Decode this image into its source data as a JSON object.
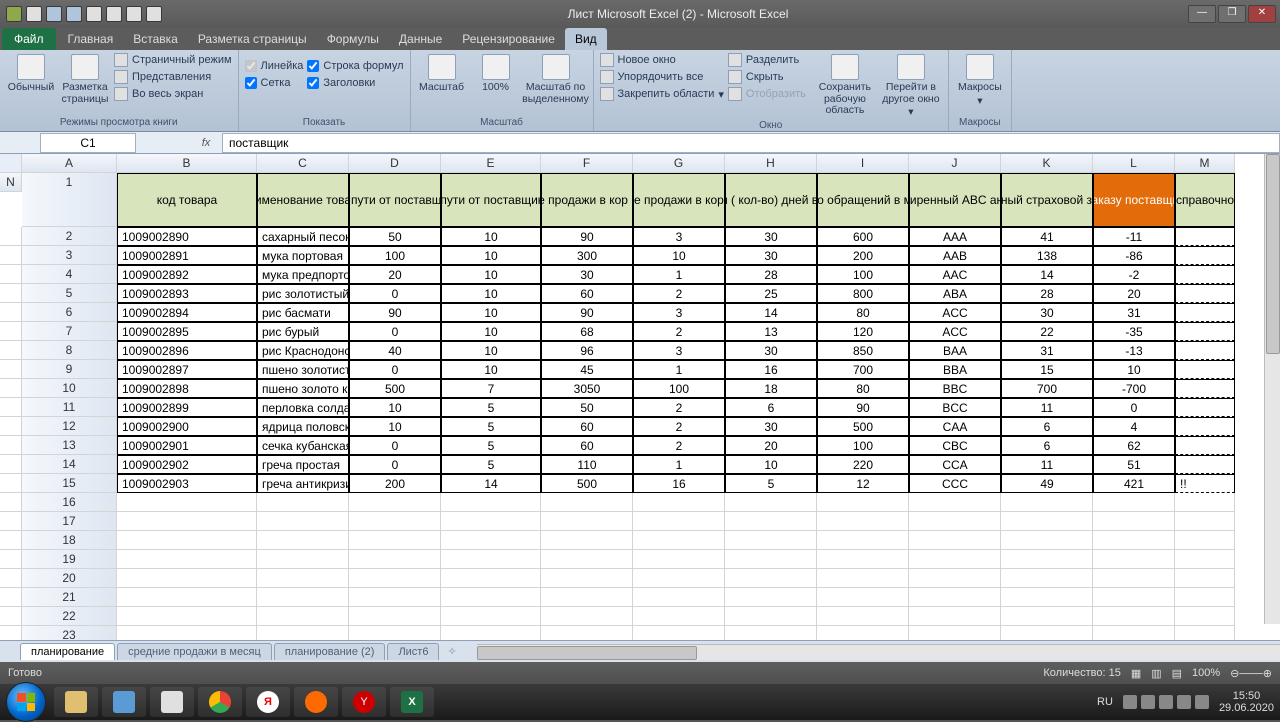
{
  "titlebar": {
    "title": "Лист Microsoft Excel (2)  -  Microsoft Excel"
  },
  "tabs": {
    "file": "Файл",
    "t1": "Главная",
    "t2": "Вставка",
    "t3": "Разметка страницы",
    "t4": "Формулы",
    "t5": "Данные",
    "t6": "Рецензирование",
    "t7": "Вид"
  },
  "ribbon": {
    "group_views": {
      "normal": "Обычный",
      "pagelayout": "Разметка страницы",
      "pagebreak": "Страничный режим",
      "customviews": "Представления",
      "fullscreen": "Во весь экран",
      "label": "Режимы просмотра книги"
    },
    "group_show": {
      "ruler": "Линейка",
      "formulabar": "Строка формул",
      "gridlines": "Сетка",
      "headings": "Заголовки",
      "label": "Показать"
    },
    "group_zoom": {
      "zoom": "Масштаб",
      "z100": "100%",
      "zoomsel": "Масштаб по выделенному",
      "label": "Масштаб"
    },
    "group_window": {
      "newwin": "Новое окно",
      "arrange": "Упорядочить все",
      "freeze": "Закрепить области",
      "split": "Разделить",
      "hide": "Скрыть",
      "unhide": "Отобразить",
      "savews": "Сохранить рабочую область",
      "switchwin": "Перейти в другое окно",
      "label": "Окно"
    },
    "group_macros": {
      "macros": "Макросы",
      "label": "Макросы"
    }
  },
  "namebox": "C1",
  "fx": "поставщик",
  "cols": [
    "A",
    "B",
    "C",
    "D",
    "E",
    "F",
    "G",
    "H",
    "I",
    "J",
    "K",
    "L",
    "M",
    "N"
  ],
  "headers": {
    "A": "код товара",
    "B": "наименование товара",
    "C": "товары в пути от поставщика в кор",
    "D": "время в пути от поставщика в днях",
    "E": "средние продажи в кор в месяц",
    "F": "средние продажи в кор в день",
    "G": "продажи  ( кол-во) дней в месяце",
    "H": "кол-во обращений в месяц",
    "I": "расширенный ABC анализ",
    "J": "минимальный страховой запас в  кор",
    "K": "к заказу поставщику",
    "L": "справочно"
  },
  "rows": [
    {
      "n": 2,
      "A": "1009002890",
      "B": "сахарный песок",
      "C": "50",
      "D": "10",
      "E": "90",
      "F": "3",
      "G": "30",
      "H": "600",
      "I": "AAA",
      "J": "41",
      "K": "-11",
      "L": ""
    },
    {
      "n": 3,
      "A": "1009002891",
      "B": "мука портовая",
      "C": "100",
      "D": "10",
      "E": "300",
      "F": "10",
      "G": "30",
      "H": "200",
      "I": "AAB",
      "J": "138",
      "K": "-86",
      "L": ""
    },
    {
      "n": 4,
      "A": "1009002892",
      "B": "мука предпортовая",
      "C": "20",
      "D": "10",
      "E": "30",
      "F": "1",
      "G": "28",
      "H": "100",
      "I": "AAC",
      "J": "14",
      "K": "-2",
      "L": ""
    },
    {
      "n": 5,
      "A": "1009002893",
      "B": "рис золотистый",
      "C": "0",
      "D": "10",
      "E": "60",
      "F": "2",
      "G": "25",
      "H": "800",
      "I": "ABA",
      "J": "28",
      "K": "20",
      "L": ""
    },
    {
      "n": 6,
      "A": "1009002894",
      "B": "рис басмати",
      "C": "90",
      "D": "10",
      "E": "90",
      "F": "3",
      "G": "14",
      "H": "80",
      "I": "ACC",
      "J": "30",
      "K": "31",
      "L": ""
    },
    {
      "n": 7,
      "A": "1009002895",
      "B": "рис бурый",
      "C": "0",
      "D": "10",
      "E": "68",
      "F": "2",
      "G": "13",
      "H": "120",
      "I": "ACC",
      "J": "22",
      "K": "-35",
      "L": ""
    },
    {
      "n": 8,
      "A": "1009002896",
      "B": "рис Краснодонский",
      "C": "40",
      "D": "10",
      "E": "96",
      "F": "3",
      "G": "30",
      "H": "850",
      "I": "BAA",
      "J": "31",
      "K": "-13",
      "L": ""
    },
    {
      "n": 9,
      "A": "1009002897",
      "B": "пшено золотистое",
      "C": "0",
      "D": "10",
      "E": "45",
      "F": "1",
      "G": "16",
      "H": "700",
      "I": "BBA",
      "J": "15",
      "K": "10",
      "L": ""
    },
    {
      "n": 10,
      "A": "1009002898",
      "B": "пшено золото края",
      "C": "500",
      "D": "7",
      "E": "3050",
      "F": "100",
      "G": "18",
      "H": "80",
      "I": "BBC",
      "J": "700",
      "K": "-700",
      "L": ""
    },
    {
      "n": 11,
      "A": "1009002899",
      "B": "перловка солдатская",
      "C": "10",
      "D": "5",
      "E": "50",
      "F": "2",
      "G": "6",
      "H": "90",
      "I": "BCC",
      "J": "11",
      "K": "0",
      "L": ""
    },
    {
      "n": 12,
      "A": "1009002900",
      "B": "ядрица половская",
      "C": "10",
      "D": "5",
      "E": "60",
      "F": "2",
      "G": "30",
      "H": "500",
      "I": "CAA",
      "J": "6",
      "K": "4",
      "L": ""
    },
    {
      "n": 13,
      "A": "1009002901",
      "B": "сечка кубанская",
      "C": "0",
      "D": "5",
      "E": "60",
      "F": "2",
      "G": "20",
      "H": "100",
      "I": "CBC",
      "J": "6",
      "K": "62",
      "L": ""
    },
    {
      "n": 14,
      "A": "1009002902",
      "B": "греча простая",
      "C": "0",
      "D": "5",
      "E": "110",
      "F": "1",
      "G": "10",
      "H": "220",
      "I": "CCA",
      "J": "11",
      "K": "51",
      "L": ""
    },
    {
      "n": 15,
      "A": "1009002903",
      "B": "греча антикризисная",
      "C": "200",
      "D": "14",
      "E": "500",
      "F": "16",
      "G": "5",
      "H": "12",
      "I": "CCC",
      "J": "49",
      "K": "421",
      "L": "!!"
    }
  ],
  "emptyrows": [
    16,
    17,
    18,
    19,
    20,
    21,
    22,
    23
  ],
  "sheets": {
    "s1": "планирование",
    "s2": "средние продажи в месяц",
    "s3": "планирование (2)",
    "s4": "Лист6"
  },
  "statusbar": {
    "ready": "Готово",
    "count": "Количество: 15",
    "zoom": "100%"
  },
  "taskbar": {
    "lang": "RU",
    "time": "15:50",
    "date": "29.06.2020"
  }
}
